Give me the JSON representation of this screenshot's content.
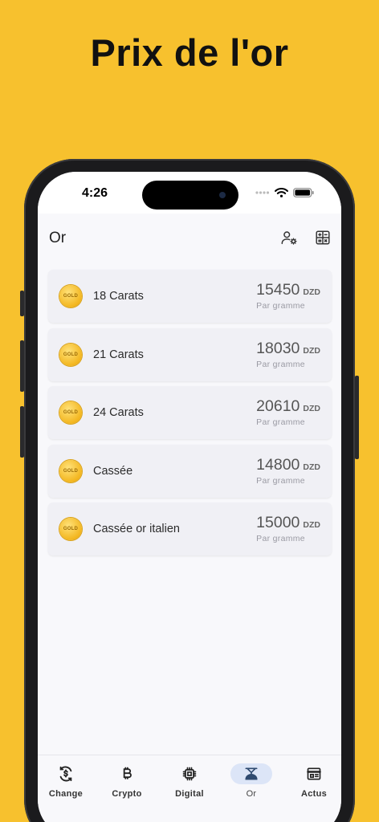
{
  "headline": "Prix de l'or",
  "status": {
    "time": "4:26"
  },
  "header": {
    "title": "Or"
  },
  "gold_items": [
    {
      "name": "18 Carats",
      "price": "15450",
      "currency": "DZD",
      "unit": "Par gramme",
      "coin_label": "GOLD"
    },
    {
      "name": "21 Carats",
      "price": "18030",
      "currency": "DZD",
      "unit": "Par gramme",
      "coin_label": "GOLD"
    },
    {
      "name": "24 Carats",
      "price": "20610",
      "currency": "DZD",
      "unit": "Par gramme",
      "coin_label": "GOLD"
    },
    {
      "name": "Cassée",
      "price": "14800",
      "currency": "DZD",
      "unit": "Par gramme",
      "coin_label": "GOLD"
    },
    {
      "name": "Cassée or italien",
      "price": "15000",
      "currency": "DZD",
      "unit": "Par gramme",
      "coin_label": "GOLD"
    }
  ],
  "tabs": [
    {
      "label": "Change",
      "icon": "currency-exchange-icon"
    },
    {
      "label": "Crypto",
      "icon": "bitcoin-icon"
    },
    {
      "label": "Digital",
      "icon": "chip-icon"
    },
    {
      "label": "Or",
      "icon": "scale-icon",
      "active": true
    },
    {
      "label": "Actus",
      "icon": "newspaper-icon"
    }
  ],
  "colors": {
    "background": "#F7C12E",
    "tab_active": "#DCE5F7",
    "card": "#F0F0F5"
  }
}
